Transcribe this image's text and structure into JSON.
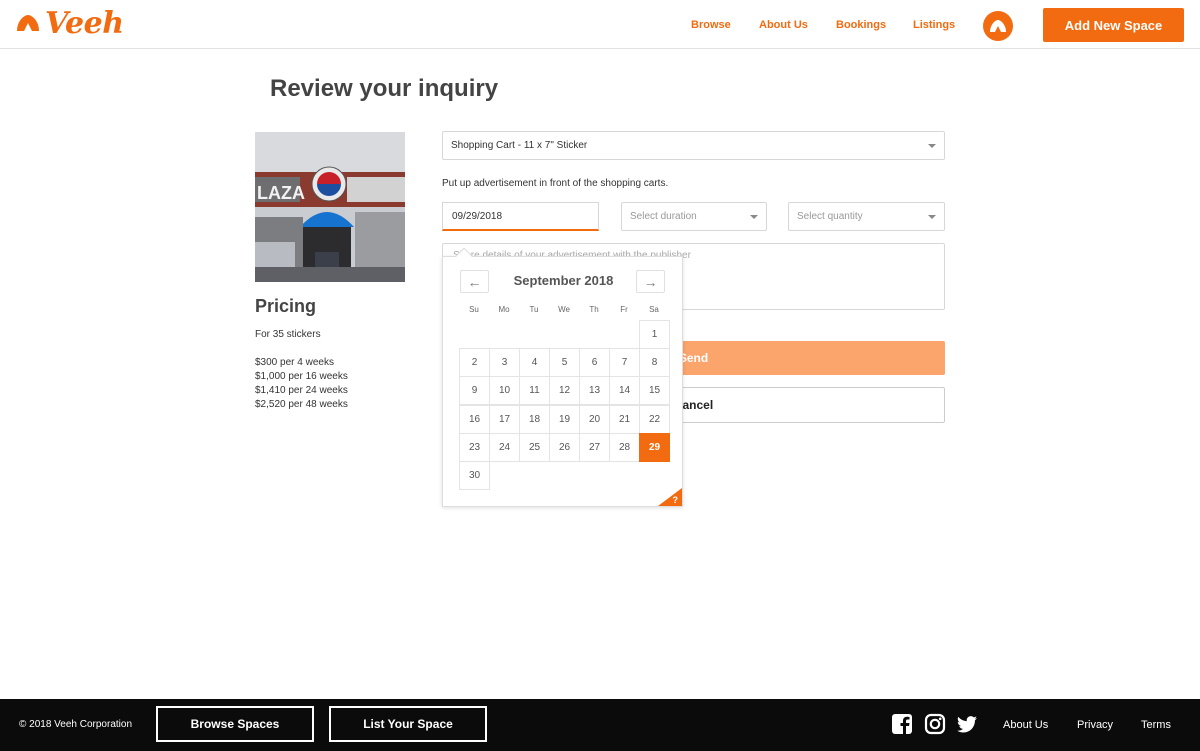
{
  "header": {
    "logo_text": "Veeh",
    "nav": [
      "Browse",
      "About Us",
      "Bookings",
      "Listings"
    ],
    "add_button": "Add New Space",
    "brand_color": "#f26b10"
  },
  "page": {
    "title": "Review your inquiry"
  },
  "listing": {
    "photo_alt": "storefront-photo",
    "sign_text": "LAZA",
    "pricing_title": "Pricing",
    "pricing_subtitle": "For 35 stickers",
    "prices": [
      "$300 per 4 weeks",
      "$1,000 per 16 weeks",
      "$1,410 per 24 weeks",
      "$2,520 per 48 weeks"
    ]
  },
  "form": {
    "product_value": "Shopping Cart - 11 x 7\" Sticker",
    "description": "Put up advertisement in front of the shopping carts.",
    "date_value": "09/29/2018",
    "duration_placeholder": "Select duration",
    "quantity_placeholder": "Select quantity",
    "details_placeholder": "Share details of your advertisement with the publisher",
    "send_label": "Send",
    "cancel_label": "Cancel"
  },
  "datepicker": {
    "prev_label": "←",
    "next_label": "→",
    "month_label": "September 2018",
    "weekdays": [
      "Su",
      "Mo",
      "Tu",
      "We",
      "Th",
      "Fr",
      "Sa"
    ],
    "days": [
      "1",
      "2",
      "3",
      "4",
      "5",
      "6",
      "7",
      "8",
      "9",
      "10",
      "11",
      "12",
      "13",
      "14",
      "15",
      "16",
      "17",
      "18",
      "19",
      "20",
      "21",
      "22",
      "23",
      "24",
      "25",
      "26",
      "27",
      "28",
      "29",
      "30"
    ],
    "selected_day": "29",
    "help_label": "?"
  },
  "footer": {
    "copyright": "© 2018 Veeh Corporation",
    "browse_button": "Browse Spaces",
    "list_button": "List Your Space",
    "social_icons": [
      "facebook-icon",
      "instagram-icon",
      "twitter-icon"
    ],
    "links": [
      "About Us",
      "Privacy",
      "Terms"
    ]
  }
}
